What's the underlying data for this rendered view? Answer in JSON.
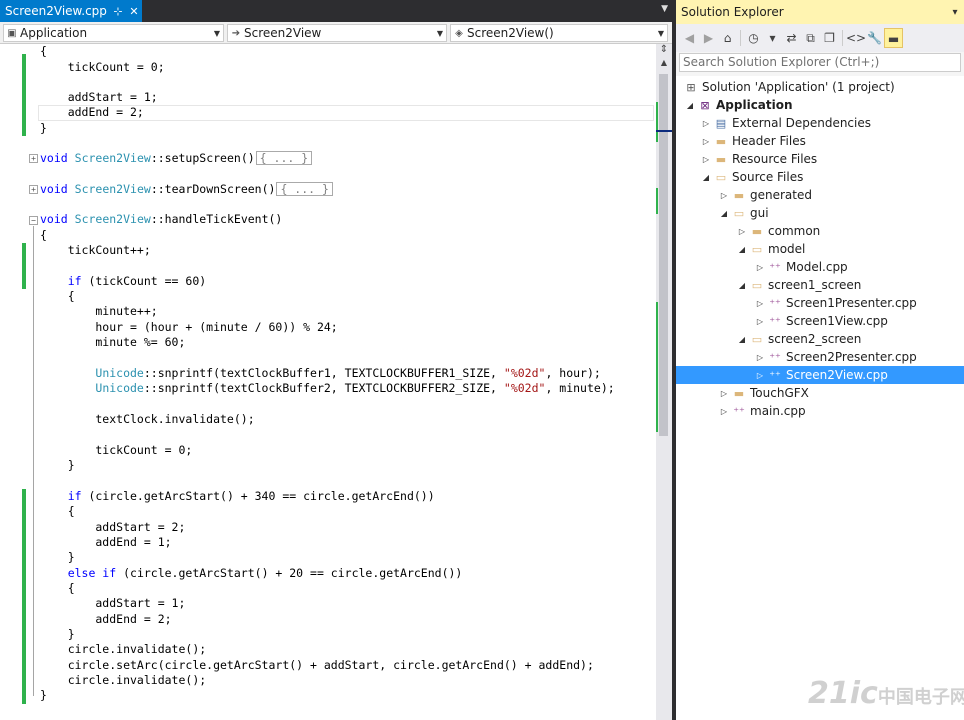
{
  "editor": {
    "tab_label": "Screen2View.cpp",
    "tab_pin": "⊹",
    "tab_close": "✕",
    "nav": {
      "project": "Application",
      "class": "Screen2View",
      "member": "Screen2View()"
    },
    "code": {
      "l01": "{",
      "l02a": "    tickCount = ",
      "l02b": "0",
      "l02c": ";",
      "l04": "    addStart = 1;",
      "l05": "    addEnd = 2;",
      "l06": "}",
      "l08_kw": "void",
      "l08_cls": "Screen2View",
      "l08_rest": "::setupScreen()",
      "collapsed": "{ ... }",
      "l10_kw": "void",
      "l10_cls": "Screen2View",
      "l10_rest": "::tearDownScreen()",
      "l12_kw": "void",
      "l12_cls": "Screen2View",
      "l12_rest": "::handleTickEvent()",
      "l13": "{",
      "l14": "    tickCount++;",
      "l16_kw": "    if",
      "l16_rest": " (tickCount == 60)",
      "l17": "    {",
      "l18": "        minute++;",
      "l19": "        hour = (hour + (minute / 60)) % 24;",
      "l20": "        minute %= 60;",
      "l22_pre": "        ",
      "l22_cls": "Unicode",
      "l22_mid": "::snprintf(textClockBuffer1, TEXTCLOCKBUFFER1_SIZE, ",
      "l22_str": "\"%02d\"",
      "l22_end": ", hour);",
      "l23_pre": "        ",
      "l23_cls": "Unicode",
      "l23_mid": "::snprintf(textClockBuffer2, TEXTCLOCKBUFFER2_SIZE, ",
      "l23_str": "\"%02d\"",
      "l23_end": ", minute);",
      "l25": "        textClock.invalidate();",
      "l27": "        tickCount = 0;",
      "l28": "    }",
      "l30_kw": "    if",
      "l30_rest": " (circle.getArcStart() + 340 == circle.getArcEnd())",
      "l31": "    {",
      "l32": "        addStart = 2;",
      "l33": "        addEnd = 1;",
      "l34": "    }",
      "l35_kw": "    else if",
      "l35_rest": " (circle.getArcStart() + 20 == circle.getArcEnd())",
      "l36": "    {",
      "l37": "        addStart = 1;",
      "l38": "        addEnd = 2;",
      "l39": "    }",
      "l40": "    circle.invalidate();",
      "l41": "    circle.setArc(circle.getArcStart() + addStart, circle.getArcEnd() + addEnd);",
      "l42": "    circle.invalidate();",
      "l43": "}"
    }
  },
  "solution_explorer": {
    "title": "Solution Explorer",
    "search_placeholder": "Search Solution Explorer (Ctrl+;)",
    "tree": [
      {
        "label": "Solution 'Application' (1 project)",
        "icon": "solution-icon"
      },
      {
        "label": "Application",
        "icon": "project-icon",
        "bold": true
      },
      {
        "label": "External Dependencies",
        "icon": "external-deps-icon"
      },
      {
        "label": "Header Files",
        "icon": "folder-icon"
      },
      {
        "label": "Resource Files",
        "icon": "folder-icon"
      },
      {
        "label": "Source Files",
        "icon": "folder-open-icon"
      },
      {
        "label": "generated",
        "icon": "folder-icon"
      },
      {
        "label": "gui",
        "icon": "folder-open-icon"
      },
      {
        "label": "common",
        "icon": "folder-icon"
      },
      {
        "label": "model",
        "icon": "folder-open-icon"
      },
      {
        "label": "Model.cpp",
        "icon": "cpp-file-icon"
      },
      {
        "label": "screen1_screen",
        "icon": "folder-open-icon"
      },
      {
        "label": "Screen1Presenter.cpp",
        "icon": "cpp-file-icon"
      },
      {
        "label": "Screen1View.cpp",
        "icon": "cpp-file-icon"
      },
      {
        "label": "screen2_screen",
        "icon": "folder-open-icon"
      },
      {
        "label": "Screen2Presenter.cpp",
        "icon": "cpp-file-icon"
      },
      {
        "label": "Screen2View.cpp",
        "icon": "cpp-file-icon",
        "selected": true
      },
      {
        "label": "TouchGFX",
        "icon": "folder-icon"
      },
      {
        "label": "main.cpp",
        "icon": "cpp-file-icon"
      }
    ]
  },
  "watermark": {
    "brand": "21ic",
    "suffix": "中国电子网"
  },
  "colors": {
    "accent": "#007acc",
    "change_bar": "#2fb24c",
    "selection": "#3399ff",
    "keyword": "#0000ff",
    "type": "#2b91af",
    "string": "#a31515"
  }
}
